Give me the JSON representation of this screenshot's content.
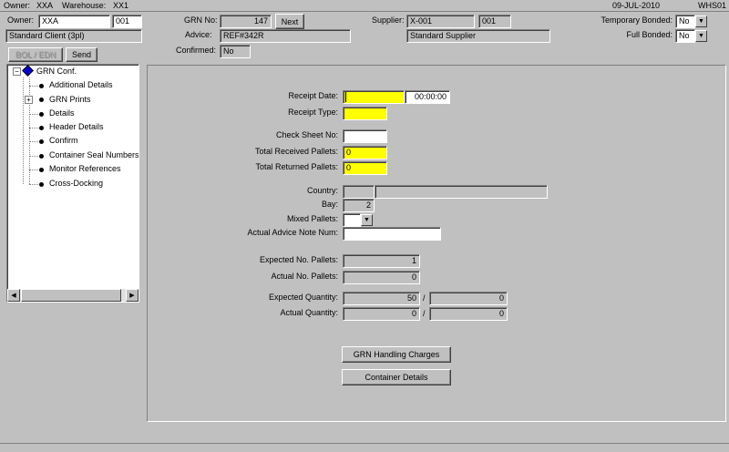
{
  "status_top": {
    "owner_label": "Owner:",
    "owner_value": "XXA",
    "warehouse_label": "Warehouse:",
    "warehouse_value": "XX1",
    "date": "09-JUL-2010",
    "user": "WHS01"
  },
  "header": {
    "owner_label": "Owner:",
    "owner_code": "XXA",
    "owner_num": "001",
    "owner_name": "Standard Client (3pl)",
    "grn_no_label": "GRN No:",
    "grn_no": "147",
    "next_button": "Next",
    "advice_label": "Advice:",
    "advice": "REF#342R",
    "confirmed_label": "Confirmed:",
    "confirmed": "No",
    "supplier_label": "Supplier:",
    "supplier_code": "X-001",
    "supplier_num": "001",
    "supplier_name": "Standard Supplier",
    "temp_bonded_label": "Temporary Bonded:",
    "temp_bonded": "No",
    "full_bonded_label": "Full Bonded:",
    "full_bonded": "No"
  },
  "actions": {
    "bol_edn": "BOL / EDN",
    "send": "Send"
  },
  "tree": {
    "root": "GRN Conf.",
    "items": [
      "Additional Details",
      "GRN Prints",
      "Details",
      "Header Details",
      "Confirm",
      "Container Seal Numbers",
      "Monitor References",
      "Cross-Docking"
    ]
  },
  "form": {
    "receipt_date_label": "Receipt Date:",
    "receipt_date": "",
    "receipt_time": "00:00:00",
    "receipt_type_label": "Receipt Type:",
    "receipt_type": "",
    "check_sheet_label": "Check Sheet No:",
    "check_sheet": "",
    "total_received_label": "Total Received Pallets:",
    "total_received": "0",
    "total_returned_label": "Total Returned Pallets:",
    "total_returned": "0",
    "country_label": "Country:",
    "country_code": "",
    "country_name": "",
    "bay_label": "Bay:",
    "bay": "2",
    "mixed_pallets_label": "Mixed Pallets:",
    "mixed_pallets": "",
    "actual_advice_label": "Actual Advice Note Num:",
    "actual_advice": "",
    "expected_pallets_label": "Expected No. Pallets:",
    "expected_pallets": "1",
    "actual_pallets_label": "Actual No. Pallets:",
    "actual_pallets": "0",
    "expected_qty_label": "Expected Quantity:",
    "expected_qty_1": "50",
    "expected_qty_2": "0",
    "actual_qty_label": "Actual Quantity:",
    "actual_qty_1": "0",
    "actual_qty_2": "0",
    "separator": "/",
    "grn_charges_button": "GRN Handling Charges",
    "container_details_button": "Container Details"
  },
  "colors": {
    "background": "#c0c0c0",
    "required_field": "#ffff00",
    "tree_root_icon": "#0000cc"
  }
}
